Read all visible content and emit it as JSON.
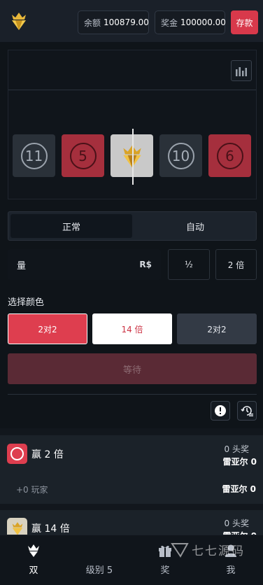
{
  "header": {
    "balance_label": "余额",
    "balance_value": "100879.00",
    "bonus_label": "奖金",
    "bonus_value": "100000.00",
    "deposit_label": "存款"
  },
  "game": {
    "tiles": [
      {
        "type": "black",
        "number": "11"
      },
      {
        "type": "red",
        "number": "5"
      },
      {
        "type": "gold",
        "number": ""
      },
      {
        "type": "black",
        "number": "10"
      },
      {
        "type": "red",
        "number": "6"
      }
    ]
  },
  "mode": {
    "normal_label": "正常",
    "auto_label": "自动"
  },
  "bet": {
    "amount_label": "量",
    "currency": "R$",
    "half_label": "½",
    "double_label": "2 倍"
  },
  "colors": {
    "section_label": "选择颜色",
    "red_label": "2对2",
    "white_label": "14 倍",
    "black_label": "2对2",
    "red": "#de3e4f",
    "black": "#333a45"
  },
  "wait_label": "等待",
  "results": [
    {
      "badge": "red",
      "win_label": "赢 2 倍",
      "jackpot": "0 头奖",
      "player": "雷亚尔 0",
      "players_count": "+0 玩家",
      "player_sum": "雷亚尔 0"
    },
    {
      "badge": "gold",
      "win_label": "赢 14 倍",
      "jackpot": "0 头奖",
      "player": "雷亚尔 0"
    }
  ],
  "nav": [
    {
      "label": "双",
      "icon": "crown-icon",
      "active": true
    },
    {
      "label": "级别 5",
      "icon": "",
      "active": false
    },
    {
      "label": "奖",
      "icon": "gift-icon",
      "active": false
    },
    {
      "label": "我",
      "icon": "user-icon",
      "active": false
    }
  ],
  "watermark": "七七源码"
}
